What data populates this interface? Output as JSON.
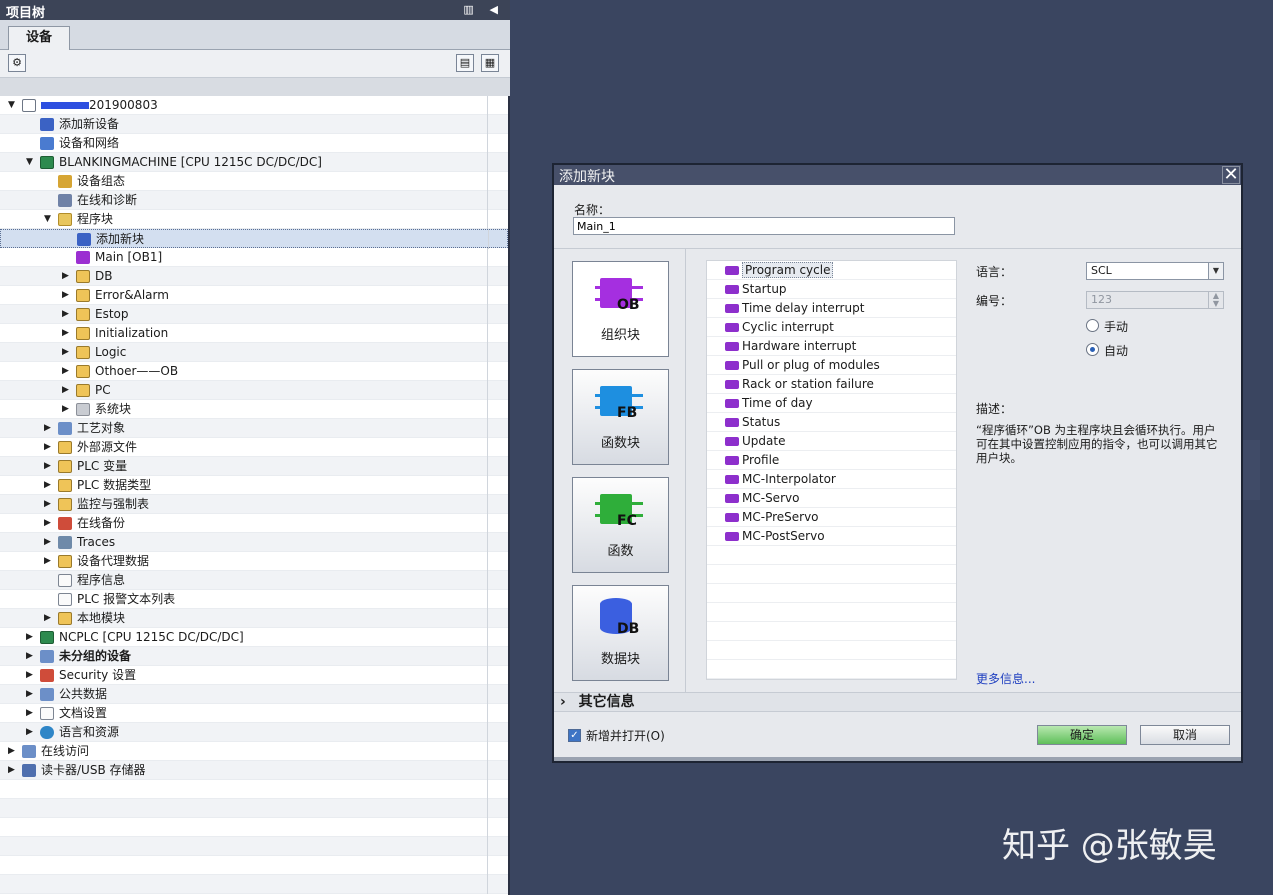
{
  "tree_panel": {
    "title": "项目树",
    "tab": "设备",
    "rows": [
      {
        "label": "201900803",
        "redacted_prefix": true
      },
      {
        "label": "添加新设备"
      },
      {
        "label": "设备和网络"
      },
      {
        "label": "BLANKINGMACHINE [CPU 1215C DC/DC/DC]"
      },
      {
        "label": "设备组态"
      },
      {
        "label": "在线和诊断"
      },
      {
        "label": "程序块"
      },
      {
        "label": "添加新块"
      },
      {
        "label": "Main [OB1]"
      },
      {
        "label": "DB"
      },
      {
        "label": "Error&Alarm"
      },
      {
        "label": "Estop"
      },
      {
        "label": "Initialization"
      },
      {
        "label": "Logic"
      },
      {
        "label": "Othoer——OB"
      },
      {
        "label": "PC"
      },
      {
        "label": "系统块"
      },
      {
        "label": "工艺对象"
      },
      {
        "label": "外部源文件"
      },
      {
        "label": "PLC 变量"
      },
      {
        "label": "PLC 数据类型"
      },
      {
        "label": "监控与强制表"
      },
      {
        "label": "在线备份"
      },
      {
        "label": "Traces"
      },
      {
        "label": "设备代理数据"
      },
      {
        "label": "程序信息"
      },
      {
        "label": "PLC 报警文本列表"
      },
      {
        "label": "本地模块"
      },
      {
        "label": "NCPLC [CPU 1215C DC/DC/DC]"
      },
      {
        "label": "未分组的设备"
      },
      {
        "label": "Security 设置"
      },
      {
        "label": "公共数据"
      },
      {
        "label": "文档设置"
      },
      {
        "label": "语言和资源"
      },
      {
        "label": "在线访问"
      },
      {
        "label": "读卡器/USB 存储器"
      }
    ]
  },
  "dialog": {
    "title": "添加新块",
    "close_icon": "✕",
    "name_label": "名称：",
    "name_value": "Main_1",
    "block_types": [
      {
        "label": "组织块",
        "tag": "OB",
        "color": "#a52fe0"
      },
      {
        "label": "函数块",
        "tag": "FB",
        "color": "#1e8fe0"
      },
      {
        "label": "函数",
        "tag": "FC",
        "color": "#2fae3a"
      },
      {
        "label": "数据块",
        "tag": "DB",
        "color": "#3b5fe0"
      }
    ],
    "ob_list": [
      "Program cycle",
      "Startup",
      "Time delay interrupt",
      "Cyclic interrupt",
      "Hardware interrupt",
      "Pull or plug of modules",
      "Rack or station failure",
      "Time of day",
      "Status",
      "Update",
      "Profile",
      "MC-Interpolator",
      "MC-Servo",
      "MC-PreServo",
      "MC-PostServo"
    ],
    "language_label": "语言：",
    "language_value": "SCL",
    "number_label": "编号：",
    "number_value": "123",
    "radio_manual": "手动",
    "radio_auto": "自动",
    "description_label": "描述：",
    "description_text": "“程序循环”OB 为主程序块且会循环执行。用户可在其中设置控制应用的指令，也可以调用其它用户块。",
    "more_info": "更多信息...",
    "other_info": "其它信息",
    "add_and_open_label": "新增并打开(O)",
    "add_and_open_checked": true,
    "ok_label": "确定",
    "cancel_label": "取消"
  },
  "watermark": "知乎 @张敏昊"
}
